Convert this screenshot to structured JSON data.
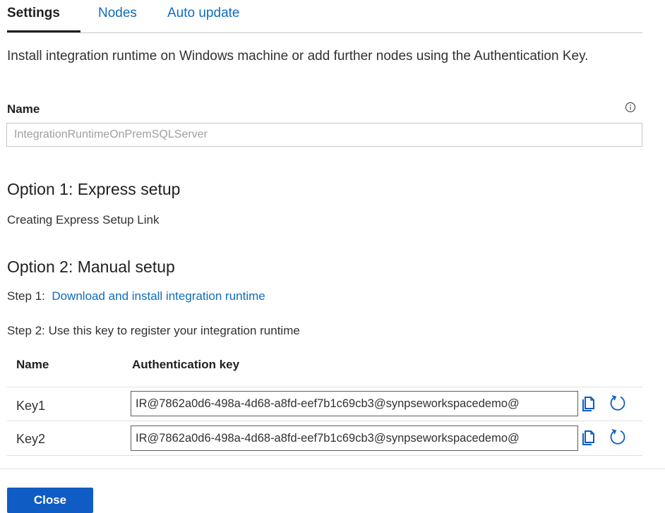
{
  "tabs": [
    {
      "label": "Settings",
      "active": true
    },
    {
      "label": "Nodes",
      "active": false
    },
    {
      "label": "Auto update",
      "active": false
    }
  ],
  "description": "Install integration runtime on Windows machine or add further nodes using the Authentication Key.",
  "name_field": {
    "label": "Name",
    "value": "IntegrationRuntimeOnPremSQLServer",
    "info_icon": "info-circle-icon"
  },
  "option1": {
    "heading": "Option 1: Express setup",
    "status": "Creating Express Setup Link"
  },
  "option2": {
    "heading": "Option 2: Manual setup",
    "step1_prefix": "Step 1:",
    "step1_link": "Download and install integration runtime",
    "step2": "Step 2: Use this key to register your integration runtime"
  },
  "keys_table": {
    "headers": [
      "Name",
      "Authentication key"
    ],
    "rows": [
      {
        "name": "Key1",
        "key": "IR@7862a0d6-498a-4d68-a8fd-eef7b1c69cb3@synpseworkspacedemo@"
      },
      {
        "name": "Key2",
        "key": "IR@7862a0d6-498a-4d68-a8fd-eef7b1c69cb3@synpseworkspacedemo@"
      }
    ],
    "copy_icon": "copy-icon",
    "regenerate_icon": "refresh-icon"
  },
  "footer": {
    "close_label": "Close"
  },
  "colors": {
    "link": "#0f6cbd",
    "primary_button": "#0f5cc4",
    "border": "#c8c6c4"
  }
}
